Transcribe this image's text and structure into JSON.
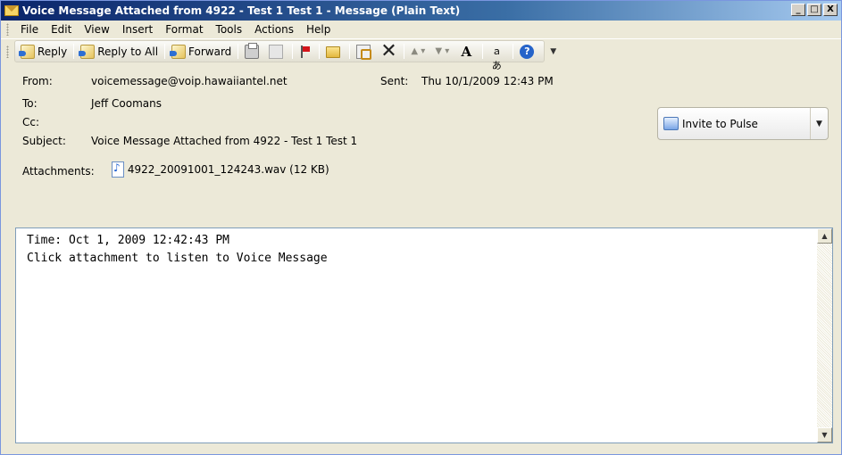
{
  "window": {
    "title": "Voice Message Attached from 4922 - Test 1 Test 1 - Message (Plain Text)",
    "controls": {
      "minimize": "_",
      "maximize": "□",
      "close": "X"
    }
  },
  "menubar": {
    "items": [
      {
        "label": "File"
      },
      {
        "label": "Edit"
      },
      {
        "label": "View"
      },
      {
        "label": "Insert"
      },
      {
        "label": "Format"
      },
      {
        "label": "Tools"
      },
      {
        "label": "Actions"
      },
      {
        "label": "Help"
      }
    ]
  },
  "toolbar": {
    "reply_label": "Reply",
    "reply_all_label": "Reply to All",
    "forward_label": "Forward",
    "icons": [
      "print-icon",
      "copy-icon",
      "flag-icon",
      "folder-icon",
      "move-to-folder-icon",
      "delete-icon",
      "previous-item-icon",
      "next-item-icon",
      "font-size-icon",
      "encoding-icon",
      "help-icon"
    ]
  },
  "message": {
    "from_label": "From:",
    "from": "voicemessage@voip.hawaiiantel.net",
    "sent_label": "Sent:",
    "sent": "Thu 10/1/2009 12:43 PM",
    "to_label": "To:",
    "to": "Jeff Coomans",
    "cc_label": "Cc:",
    "cc": "",
    "subject_label": "Subject:",
    "subject": "Voice Message Attached from 4922 - Test 1 Test 1",
    "attachments_label": "Attachments:",
    "attachment": "4922_20091001_124243.wav (12 KB)",
    "invite_label": "Invite to Pulse"
  },
  "body": {
    "line1": "Time: Oct 1, 2009 12:42:43 PM",
    "line2": "Click attachment to listen to Voice Message"
  }
}
